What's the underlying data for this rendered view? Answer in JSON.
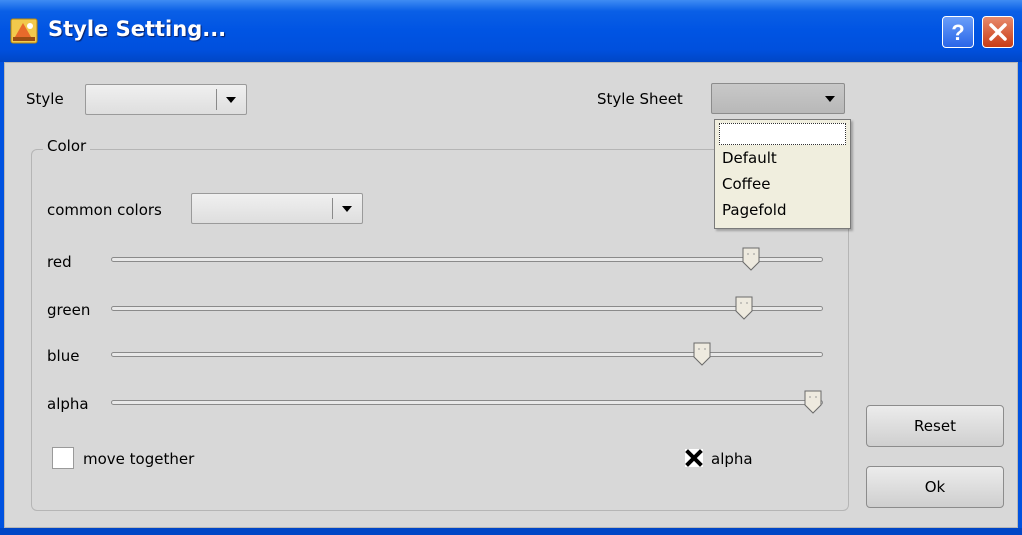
{
  "window": {
    "title": "Style Setting...",
    "icons": {
      "app": "style-app-icon",
      "help": "help-icon",
      "close": "close-icon"
    }
  },
  "style": {
    "label": "Style",
    "value": ""
  },
  "style_sheet": {
    "label": "Style Sheet",
    "value": "",
    "options": [
      "",
      "Default",
      "Coffee",
      "Pagefold"
    ]
  },
  "color_group": {
    "title": "Color",
    "common_colors": {
      "label": "common colors",
      "value": ""
    },
    "sliders": [
      {
        "label": "red",
        "level": 0.91
      },
      {
        "label": "green",
        "level": 0.9
      },
      {
        "label": "blue",
        "level": 0.84
      },
      {
        "label": "alpha",
        "level": 1.0
      }
    ],
    "move_together": {
      "label": "move together",
      "checked": false
    },
    "alpha_check": {
      "label": "alpha",
      "checked": true
    }
  },
  "buttons": {
    "reset": "Reset",
    "ok": "Ok"
  },
  "colors": {
    "titlebar": "#0054e3",
    "client": "#d8d8d8",
    "dropdown_bg": "#f0eede"
  }
}
